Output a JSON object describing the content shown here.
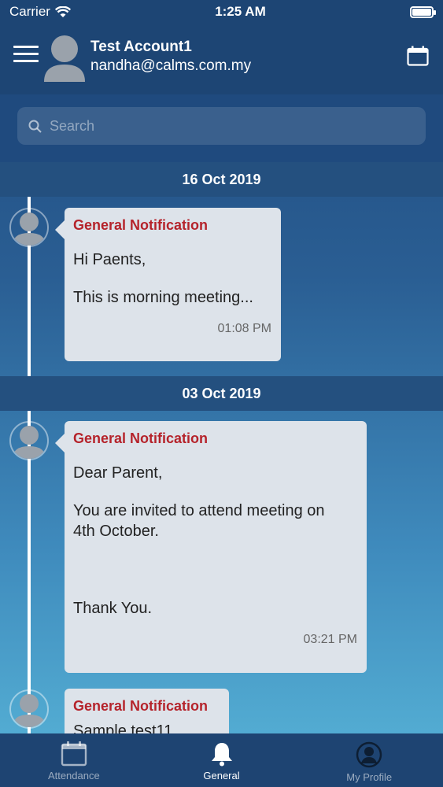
{
  "status_bar": {
    "carrier": "Carrier",
    "time": "1:25 AM"
  },
  "header": {
    "account_name": "Test Account1",
    "account_email": "nandha@calms.com.my"
  },
  "search": {
    "placeholder": "Search"
  },
  "groups": [
    {
      "date": "16 Oct 2019",
      "notifications": [
        {
          "title": "General Notification",
          "lines": [
            "Hi Paents,",
            "This is morning meeting..."
          ],
          "time": "01:08 PM"
        }
      ]
    },
    {
      "date": "03 Oct 2019",
      "notifications": [
        {
          "title": "General Notification",
          "lines": [
            "Dear Parent,",
            "You are invited to attend meeting on",
            "4th October.",
            "Thank You."
          ],
          "time": "03:21 PM"
        },
        {
          "title": "General Notification",
          "lines": [
            "Sample test11"
          ],
          "time": ""
        }
      ]
    }
  ],
  "tabbar": {
    "tabs": [
      {
        "label": "Attendance",
        "icon": "calendar-icon",
        "active": false
      },
      {
        "label": "General",
        "icon": "bell-icon",
        "active": true
      },
      {
        "label": "My Profile",
        "icon": "profile-icon",
        "active": false
      }
    ]
  },
  "colors": {
    "accent_red": "#b5232b",
    "header_bg": "#1d4574",
    "bubble_bg": "#dde3ea"
  }
}
